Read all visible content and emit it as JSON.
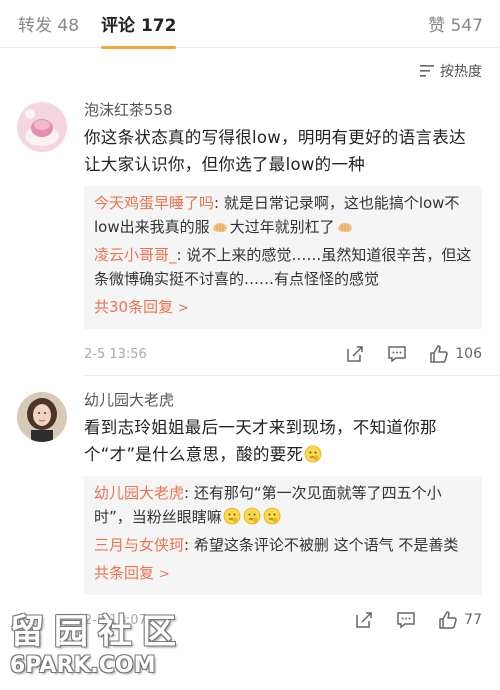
{
  "tabs": {
    "repost": "转发 48",
    "comment": "评论 172",
    "like": "赞 547"
  },
  "sort": {
    "label": "按热度",
    "icon": "sort-lines-icon"
  },
  "comments": [
    {
      "username": "泡沫红茶558",
      "content": "你这条状态真的写得很low，明明有更好的语言表达让大家认识你，但你选了最low的一种",
      "replies": [
        {
          "user": "今天鸡蛋早睡了吗",
          "text_a": ": 就是日常记录啊，这也能搞个low不low出来我真的服",
          "text_b": "大过年就别杠了"
        },
        {
          "user": "凌云小哥哥_",
          "text": ": 说不上来的感觉……虽然知道很辛苦，但这条微博确实挺不讨喜的……有点怪怪的感觉"
        }
      ],
      "more": "共30条回复",
      "time": "2-5 13:56",
      "likes": "106"
    },
    {
      "username": "幼儿园大老虎",
      "content": "看到志玲姐姐最后一天才来到现场，不知道你那个“才”是什么意思，酸的要死",
      "replies": [
        {
          "user": "幼儿园大老虎",
          "text": ": 还有那句“第一次见面就等了四五个小时”，当粉丝眼瞎嘛"
        },
        {
          "user": "三月与女侠珂",
          "text": ": 希望这条评论不被删 这个语气 不是善类"
        }
      ],
      "more": "共",
      "more_tail": "条回复",
      "time": "2-5 14:07",
      "likes": "77"
    }
  ],
  "watermark": {
    "cn": "留园社区",
    "en": "6PARK.COM"
  },
  "colors": {
    "accent": "#f7a534",
    "link": "#eb7350",
    "reply_bg": "#f5f5f5"
  }
}
